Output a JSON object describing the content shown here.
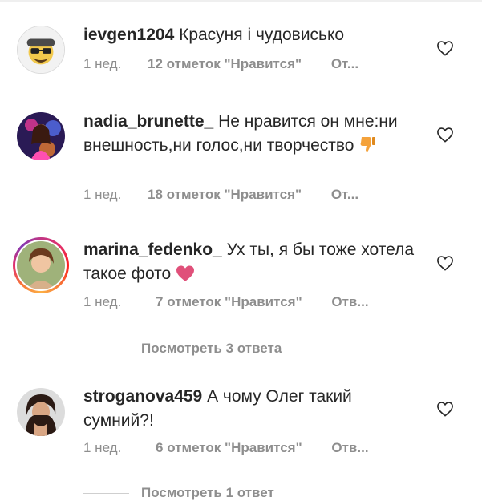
{
  "comments": [
    {
      "username": "ievgen1204",
      "text": "Красуня і чудовисько",
      "time": "1 нед.",
      "likes": "12 отметок \"Нравится\"",
      "reply": "От..."
    },
    {
      "username": "nadia_brunette_",
      "text": "Не нравится он мне:ни внешность,ни голос,ни творчество",
      "emoji": "👎",
      "time": "1 нед.",
      "likes": "18 отметок \"Нравится\"",
      "reply": "От..."
    },
    {
      "username": "marina_fedenko_",
      "text": "Ух ты, я бы тоже хотела такое фото",
      "emoji": "❤",
      "time": "1 нед.",
      "likes": "7 отметок \"Нравится\"",
      "reply": "Отв..."
    },
    {
      "username": "stroganova459",
      "text": "А чому Олег такий сумний?!",
      "time": "1 нед.",
      "likes": "6 отметок \"Нравится\"",
      "reply": "Отв..."
    }
  ],
  "view_replies": [
    "Посмотреть 3 ответа",
    "Посмотреть 1 ответ"
  ],
  "colors": {
    "text": "#262626",
    "muted": "#8e8e8e",
    "heart_emoji": "#e0507a",
    "thumb_emoji": "#f4a23b"
  },
  "icons": [
    "heart-outline-icon",
    "thumbs-down-emoji",
    "heart-emoji"
  ]
}
